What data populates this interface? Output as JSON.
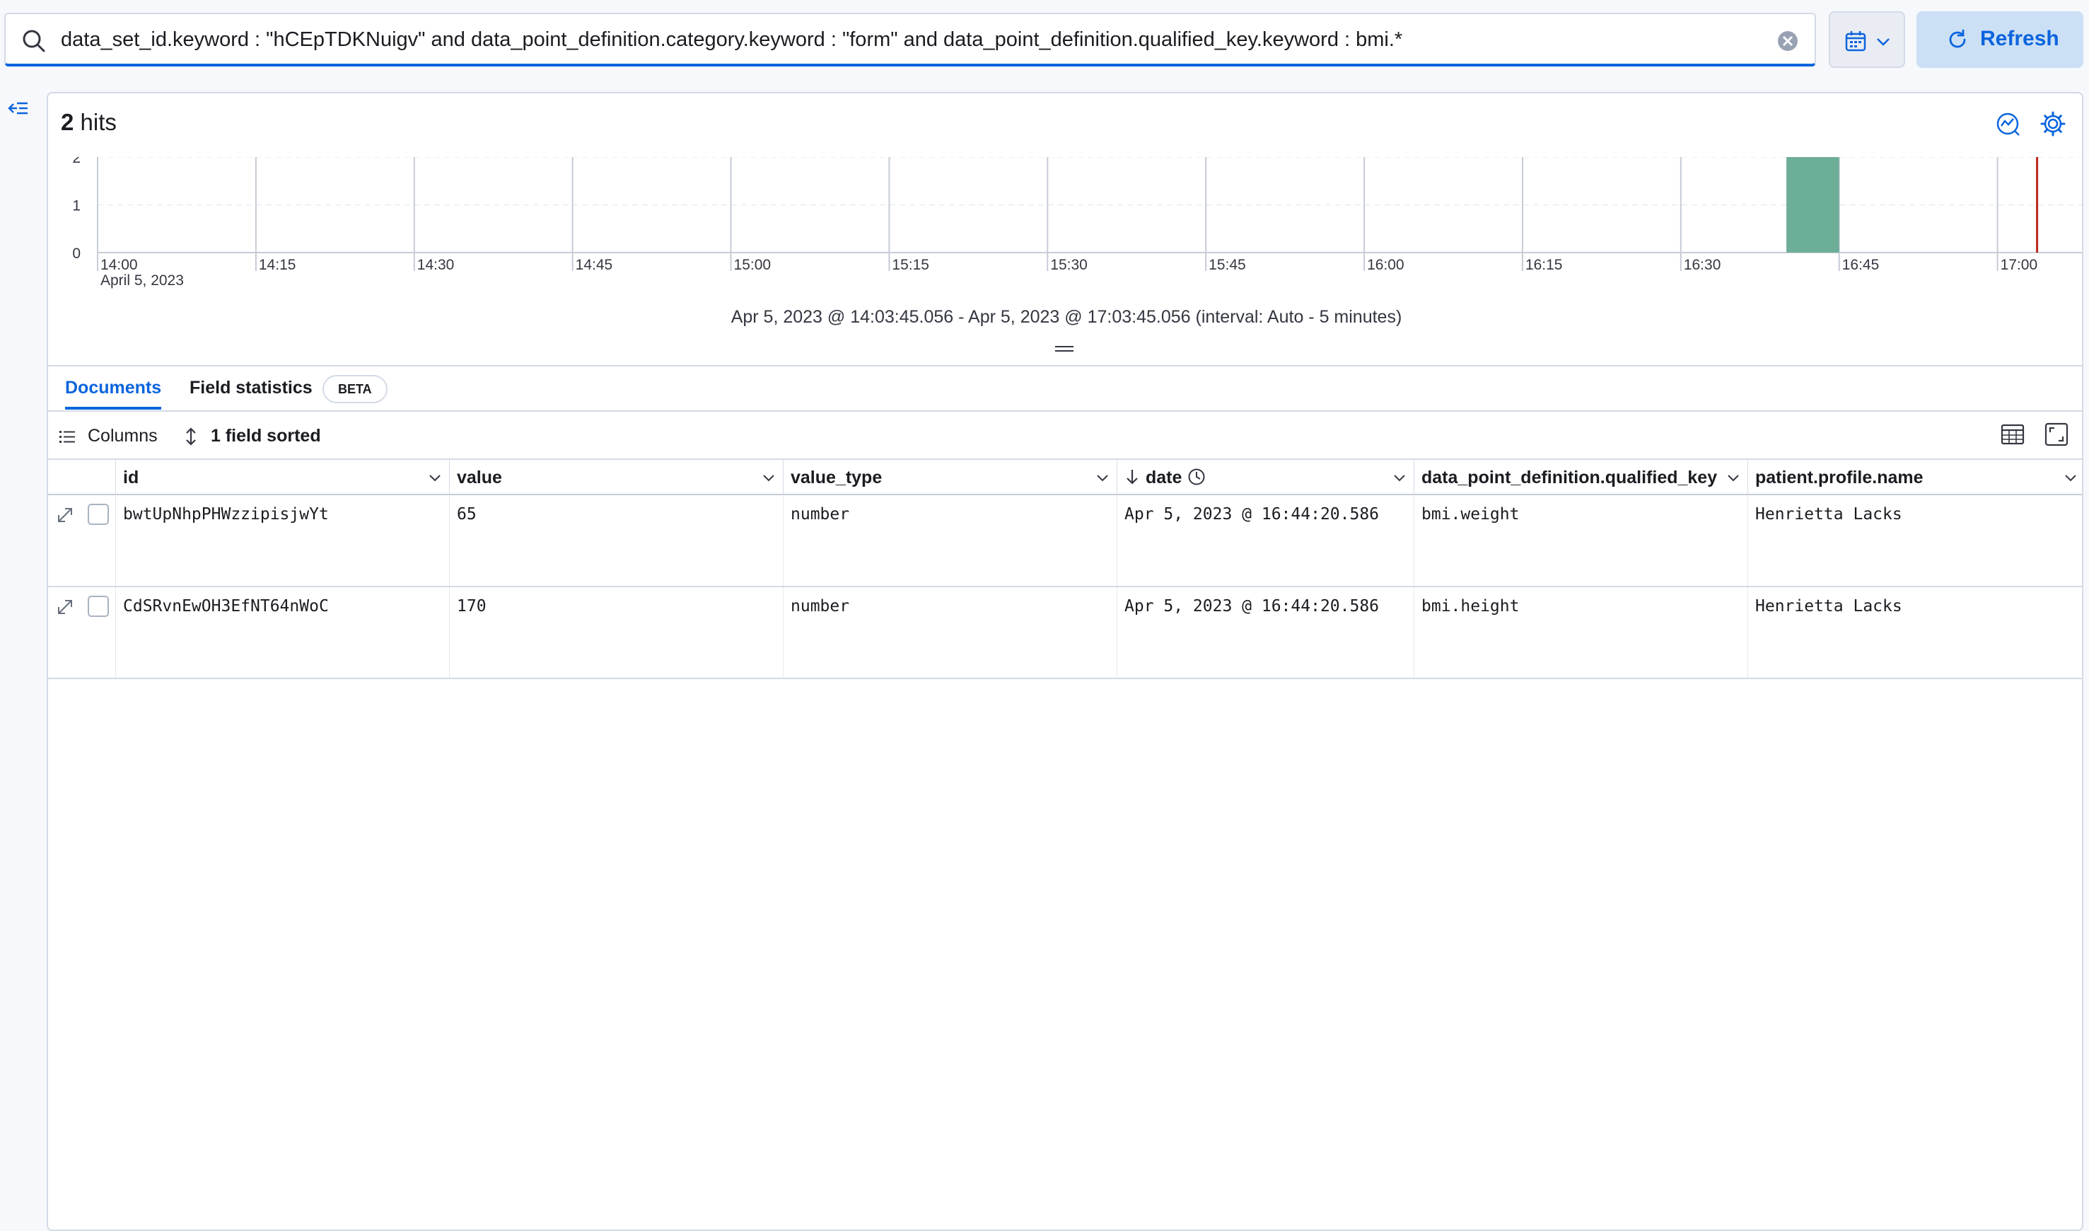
{
  "query": {
    "value": "data_set_id.keyword : \"hCEpTDKNuigv\" and data_point_definition.category.keyword : \"form\" and data_point_definition.qualified_key.keyword : bmi.*",
    "refresh_label": "Refresh"
  },
  "hits": {
    "count": "2",
    "label": "hits"
  },
  "chart_data": {
    "type": "bar",
    "y_ticks": [
      "2",
      "1",
      "0"
    ],
    "ylim": [
      0,
      2
    ],
    "x_ticks": [
      "14:00",
      "14:15",
      "14:30",
      "14:45",
      "15:00",
      "15:15",
      "15:30",
      "15:45",
      "16:00",
      "16:15",
      "16:30",
      "16:45",
      "17:00"
    ],
    "x_sub": "April 5, 2023",
    "bins": [
      {
        "start": "16:40",
        "end": "16:45",
        "count": 2
      }
    ],
    "color": "#6dae99",
    "now_marker_color": "#bd271e"
  },
  "interval_text": "Apr 5, 2023 @ 14:03:45.056 - Apr 5, 2023 @ 17:03:45.056 (interval: Auto - 5 minutes)",
  "tabs": {
    "documents": "Documents",
    "field_statistics": "Field statistics",
    "beta": "BETA"
  },
  "toolbar": {
    "columns": "Columns",
    "sorted": "1 field sorted"
  },
  "columns": [
    "id",
    "value",
    "value_type",
    "date",
    "data_point_definition.qualified_key",
    "patient.profile.name"
  ],
  "rows": [
    {
      "id": "bwtUpNhpPHWzzipisjwYt",
      "value": "65",
      "value_type": "number",
      "date": "Apr 5, 2023 @ 16:44:20.586",
      "qualified_key": "bmi.weight",
      "name": "Henrietta Lacks"
    },
    {
      "id": "CdSRvnEwOH3EfNT64nWoC",
      "value": "170",
      "value_type": "number",
      "date": "Apr 5, 2023 @ 16:44:20.586",
      "qualified_key": "bmi.height",
      "name": "Henrietta Lacks"
    }
  ],
  "colors": {
    "accent": "#0b64dd",
    "refresh_bg": "#cce0f5",
    "bar": "#6dae99",
    "marker": "#bd271e"
  }
}
